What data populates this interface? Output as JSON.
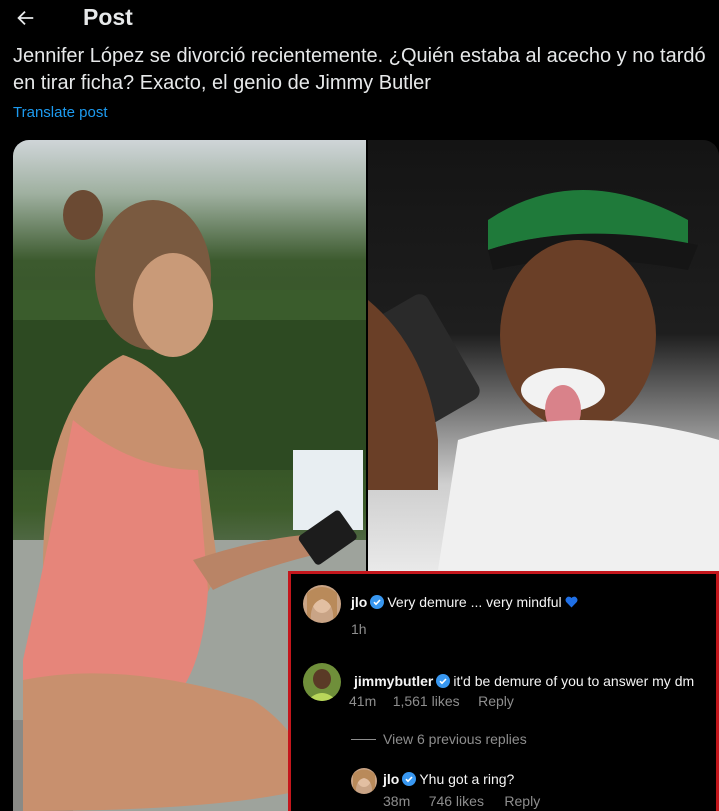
{
  "header": {
    "title": "Post",
    "back_icon": "arrow-left-icon"
  },
  "post": {
    "text": "Jennifer López se divorció recientemente. ¿Quién estaba al acecho y no tardó en tirar ficha? Exacto, el genio de Jimmy Butler",
    "translate_label": "Translate post"
  },
  "comments": {
    "first": {
      "user": "jlo",
      "text": "Very demure ... very mindful",
      "time": "1h",
      "heart_color": "#1f6fe5"
    },
    "second": {
      "user": "jimmybutler",
      "text": "it'd be demure of you to answer my dm",
      "time": "41m",
      "likes": "1,561 likes",
      "reply_label": "Reply"
    },
    "view_previous": "View 6 previous replies",
    "third": {
      "user": "jlo",
      "text": "Yhu got a ring?",
      "time": "38m",
      "likes": "746 likes",
      "reply_label": "Reply"
    }
  },
  "colors": {
    "accent": "#1d9bf0",
    "frame": "#c4161c",
    "verified": "#3897f0"
  }
}
